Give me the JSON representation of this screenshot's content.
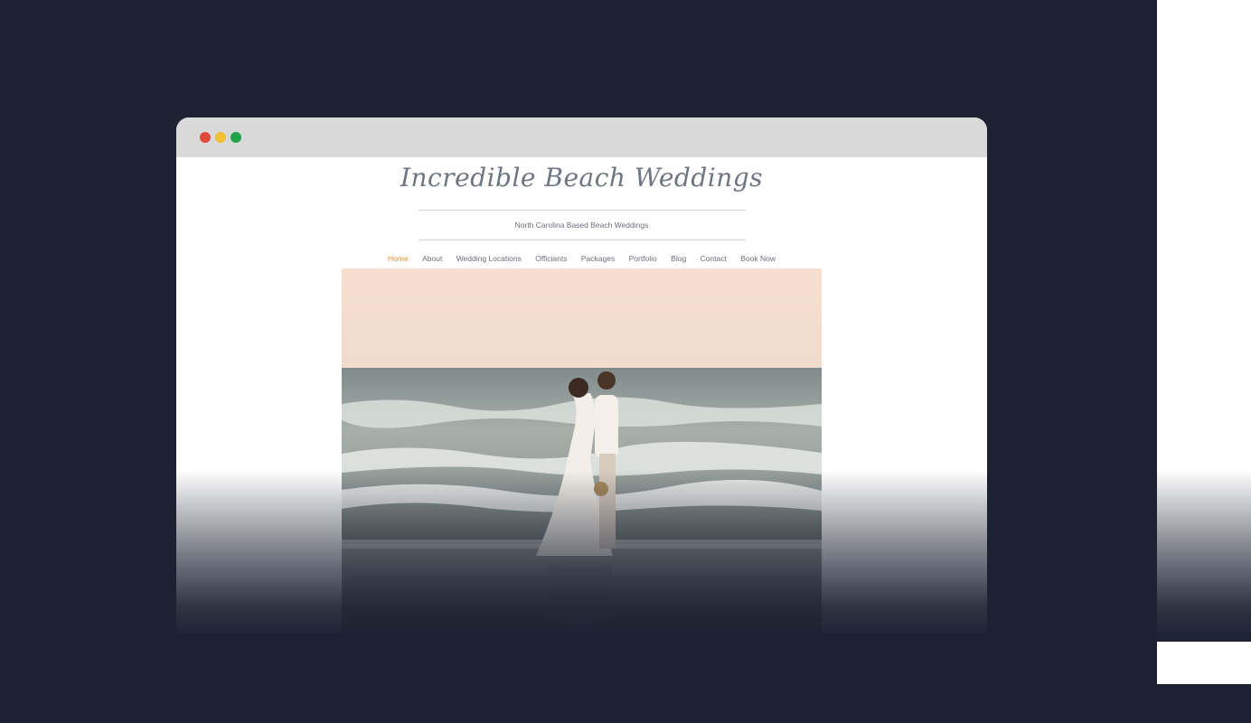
{
  "site": {
    "title": "Incredible Beach Weddings",
    "tagline": "North Carolina Based Beach Weddings"
  },
  "nav": {
    "items": [
      "Home",
      "About",
      "Wedding Locations",
      "Officiants",
      "Packages",
      "Portfolio",
      "Blog",
      "Contact",
      "Book Now"
    ],
    "active": "Home"
  },
  "window_controls": [
    "close",
    "minimize",
    "maximize"
  ],
  "colors": {
    "background": "#1c2232",
    "accent_nav": "#e08c2c",
    "title": "#6e7681",
    "dot_red": "#e2493a",
    "dot_yellow": "#f0c132",
    "dot_green": "#21a34a"
  }
}
